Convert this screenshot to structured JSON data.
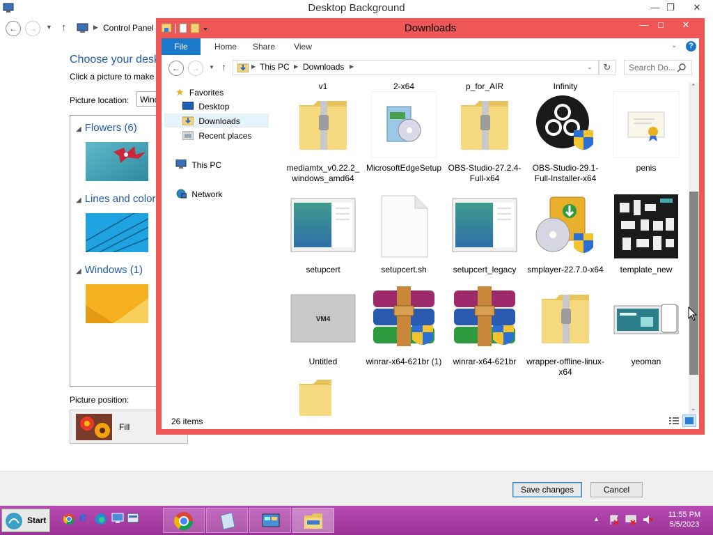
{
  "bg_window": {
    "title": "Desktop Background",
    "breadcrumb": "Control Panel",
    "heading": "Choose your desk",
    "subtitle": "Click a picture to make",
    "location_label": "Picture location:",
    "location_value": "Wind",
    "groups": [
      {
        "label": "Flowers (6)"
      },
      {
        "label": "Lines and colors"
      },
      {
        "label": "Windows (1)"
      }
    ],
    "position_label": "Picture position:",
    "position_value": "Fill",
    "save_label": "Save changes",
    "cancel_label": "Cancel"
  },
  "explorer": {
    "title": "Downloads",
    "tabs": [
      "File",
      "Home",
      "Share",
      "View"
    ],
    "address": [
      "This PC",
      "Downloads"
    ],
    "search_placeholder": "Search Do...",
    "nav": {
      "favorites": "Favorites",
      "desktop": "Desktop",
      "downloads": "Downloads",
      "recent": "Recent places",
      "thispc": "This PC",
      "network": "Network"
    },
    "partial_top_labels": [
      "v1",
      "2-x64",
      "p_for_AIR",
      "Infinity"
    ],
    "files": [
      {
        "name": "mediamtx_v0.22.2_windows_amd64",
        "icon": "zip-folder-icon"
      },
      {
        "name": "MicrosoftEdgeSetup",
        "icon": "installer-icon"
      },
      {
        "name": "OBS-Studio-27.2.4-Full-x64",
        "icon": "zip-folder-icon"
      },
      {
        "name": "OBS-Studio-29.1-Full-Installer-x64",
        "icon": "obs-icon"
      },
      {
        "name": "penis",
        "icon": "certificate-icon"
      },
      {
        "name": "setupcert",
        "icon": "app-window-icon"
      },
      {
        "name": "setupcert.sh",
        "icon": "blank-file-icon"
      },
      {
        "name": "setupcert_legacy",
        "icon": "app-window-icon"
      },
      {
        "name": "smplayer-22.7.0-x64",
        "icon": "installer-disc-icon"
      },
      {
        "name": "template_new",
        "icon": "template-image-icon"
      },
      {
        "name": "Untitled",
        "icon": "vm-image-icon"
      },
      {
        "name": "winrar-x64-621br (1)",
        "icon": "winrar-icon"
      },
      {
        "name": "winrar-x64-621br",
        "icon": "winrar-icon"
      },
      {
        "name": "wrapper-offline-linux-x64",
        "icon": "zip-folder-icon"
      },
      {
        "name": "yeoman",
        "icon": "website-image-icon"
      }
    ],
    "untitled_thumb_text": "VM4",
    "status": "26 items"
  },
  "taskbar": {
    "start_label": "Start",
    "time": "11:55 PM",
    "date": "5/5/2023"
  }
}
